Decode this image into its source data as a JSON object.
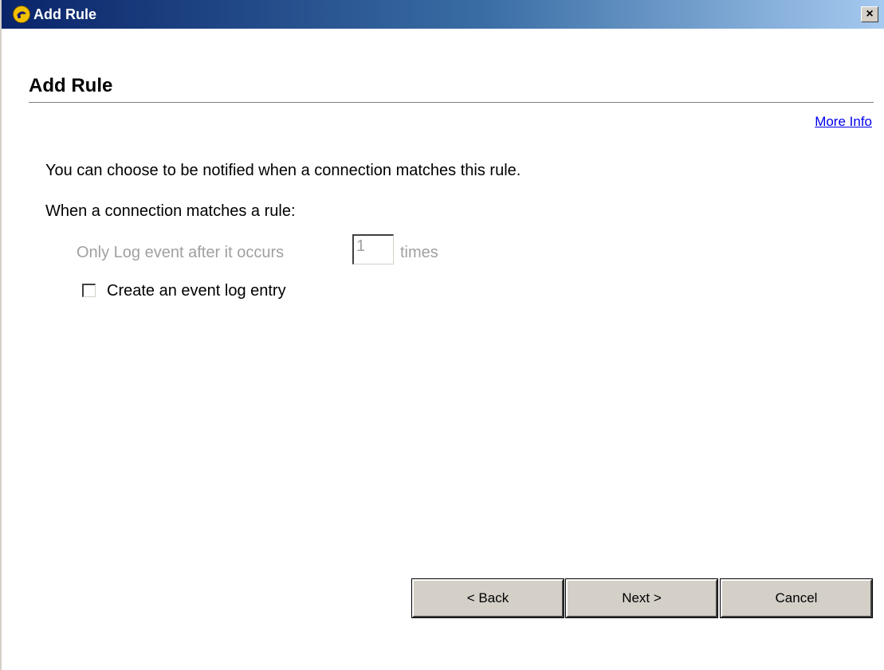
{
  "window": {
    "title": "Add Rule",
    "close_label": "×"
  },
  "page": {
    "title": "Add Rule",
    "more_info": "More Info"
  },
  "content": {
    "intro": "You can choose to be notified when a connection matches this rule.",
    "when_label": "When a connection matches a rule:",
    "log_after_prefix": "Only Log event after it occurs",
    "log_after_count": "1",
    "log_after_suffix": "times",
    "event_log_checkbox_label": "Create an event log entry",
    "event_log_checked": false
  },
  "buttons": {
    "back": "< Back",
    "next": "Next >",
    "cancel": "Cancel"
  },
  "colors": {
    "titlebar_start": "#0a246a",
    "titlebar_end": "#a6caf0",
    "disabled_text": "#a0a0a0",
    "link": "#0000ee"
  }
}
